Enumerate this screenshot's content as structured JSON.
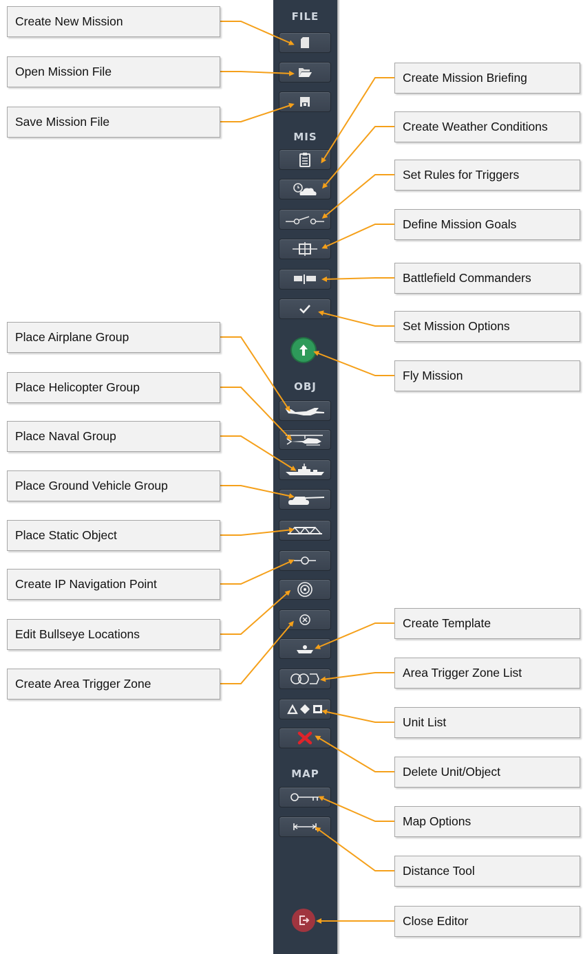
{
  "toolbar": {
    "sections": {
      "file": "FILE",
      "mis": "MIS",
      "obj": "OBJ",
      "map": "MAP"
    },
    "buttons": [
      {
        "id": "create-new-mission",
        "icon": "new-document-icon"
      },
      {
        "id": "open-mission-file",
        "icon": "folder-open-icon"
      },
      {
        "id": "save-mission-file",
        "icon": "floppy-disk-icon"
      },
      {
        "id": "mission-briefing",
        "icon": "clipboard-icon"
      },
      {
        "id": "weather-conditions",
        "icon": "cloud-clock-icon"
      },
      {
        "id": "trigger-rules",
        "icon": "switch-icon"
      },
      {
        "id": "mission-goals",
        "icon": "target-box-icon"
      },
      {
        "id": "battlefield-commanders",
        "icon": "flags-icon"
      },
      {
        "id": "mission-options",
        "icon": "checkmark-icon"
      },
      {
        "id": "airplane-group",
        "icon": "airplane-icon"
      },
      {
        "id": "helicopter-group",
        "icon": "helicopter-icon"
      },
      {
        "id": "naval-group",
        "icon": "ship-icon"
      },
      {
        "id": "ground-vehicle-group",
        "icon": "tank-icon"
      },
      {
        "id": "static-object",
        "icon": "bridge-icon"
      },
      {
        "id": "ip-navigation-point",
        "icon": "waypoint-icon"
      },
      {
        "id": "bullseye-locations",
        "icon": "bullseye-icon"
      },
      {
        "id": "area-trigger-zone",
        "icon": "circle-x-icon"
      },
      {
        "id": "create-template",
        "icon": "template-icon"
      },
      {
        "id": "trigger-zone-list",
        "icon": "rings-icon"
      },
      {
        "id": "unit-list",
        "icon": "shapes-icon"
      },
      {
        "id": "delete-unit",
        "icon": "red-x-icon"
      },
      {
        "id": "map-options",
        "icon": "key-icon"
      },
      {
        "id": "distance-tool",
        "icon": "ruler-icon"
      }
    ],
    "fly_mission_icon": "green-arrow-up-icon",
    "close_editor_icon": "exit-icon"
  },
  "callouts": {
    "create_new_mission": "Create New Mission",
    "open_mission_file": "Open Mission File",
    "save_mission_file": "Save Mission File",
    "create_mission_briefing": "Create Mission Briefing",
    "create_weather_conditions": "Create Weather Conditions",
    "set_rules_for_triggers": "Set Rules for Triggers",
    "define_mission_goals": "Define Mission Goals",
    "battlefield_commanders": "Battlefield Commanders",
    "set_mission_options": "Set Mission Options",
    "fly_mission": "Fly Mission",
    "place_airplane_group": "Place Airplane Group",
    "place_helicopter_group": "Place Helicopter Group",
    "place_naval_group": "Place Naval Group",
    "place_ground_vehicle_group": "Place Ground Vehicle Group",
    "place_static_object": "Place Static Object",
    "create_ip_navigation_point": "Create IP Navigation Point",
    "edit_bullseye_locations": "Edit Bullseye Locations",
    "create_area_trigger_zone": "Create Area Trigger Zone",
    "create_template": "Create Template",
    "area_trigger_zone_list": "Area Trigger Zone List",
    "unit_list": "Unit List",
    "delete_unit_object": "Delete Unit/Object",
    "map_options": "Map Options",
    "distance_tool": "Distance Tool",
    "close_editor": "Close Editor"
  },
  "colors": {
    "toolbar_bg": "#2f3a48",
    "leader_line": "#f5a01a",
    "fly_green": "#2e9a5a",
    "close_red": "#a0353f",
    "delete_red": "#e0232a"
  }
}
